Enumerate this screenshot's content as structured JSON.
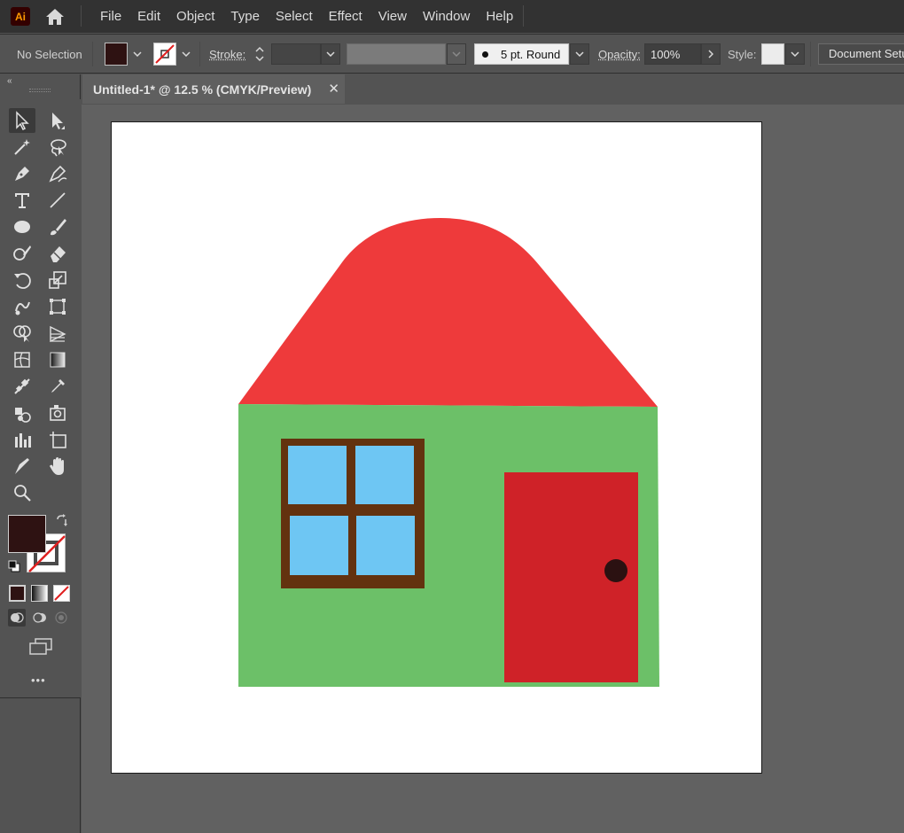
{
  "app": {
    "logo_text": "Ai"
  },
  "menu": {
    "items": [
      "File",
      "Edit",
      "Object",
      "Type",
      "Select",
      "Effect",
      "View",
      "Window",
      "Help"
    ]
  },
  "control_bar": {
    "selection_label": "No Selection",
    "stroke_label": "Stroke:",
    "brush_label": "5 pt. Round",
    "opacity_label": "Opacity:",
    "opacity_value": "100%",
    "style_label": "Style:",
    "document_setup": "Document Setup"
  },
  "document": {
    "tab_title": "Untitled-1* @ 12.5 % (CMYK/Preview)",
    "close_glyph": "✕"
  },
  "toolbar": {
    "tools": [
      "selection-tool",
      "direct-selection-tool",
      "magic-wand-tool",
      "lasso-tool",
      "pen-tool",
      "curvature-tool",
      "type-tool",
      "line-segment-tool",
      "ellipse-tool",
      "paintbrush-tool",
      "shaper-tool",
      "eraser-tool",
      "rotate-tool",
      "scale-tool",
      "warp-tool",
      "free-transform-tool",
      "shape-builder-tool",
      "perspective-grid-tool",
      "mesh-tool",
      "gradient-tool",
      "eyedropper-tool",
      "blend-tool",
      "symbol-sprayer-tool",
      "column-graph-tool",
      "artboard-tool",
      "slice-tool",
      "hand-tool",
      "zoom-tool"
    ],
    "more_glyph": "•••"
  },
  "colors": {
    "fill": "#2e1212",
    "roof": "#ee3a3b",
    "walls": "#6cc068",
    "window_frame": "#63320f",
    "window_glass": "#6ec6f3",
    "door": "#cf2228",
    "door_knob": "#2b1111"
  }
}
